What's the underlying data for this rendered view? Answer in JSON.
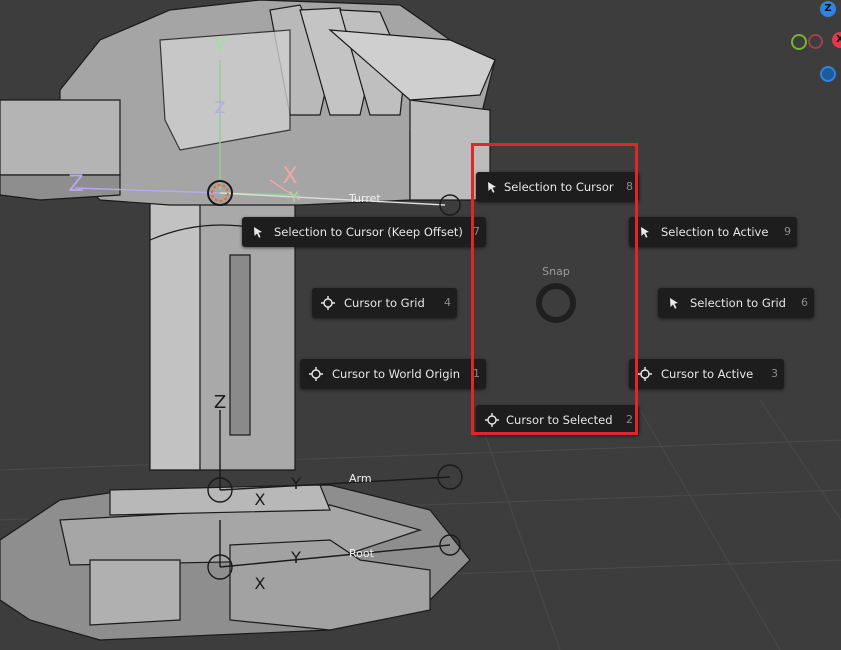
{
  "pie_menu": {
    "title": "Snap",
    "items": [
      {
        "label": "Selection to Cursor",
        "key": "8",
        "icon": "cursor-arrow-icon"
      },
      {
        "label": "Selection to Cursor (Keep Offset)",
        "key": "7",
        "icon": "cursor-arrow-icon"
      },
      {
        "label": "Selection to Active",
        "key": "9",
        "icon": "cursor-arrow-icon"
      },
      {
        "label": "Cursor to Grid",
        "key": "4",
        "icon": "3d-cursor-icon"
      },
      {
        "label": "Selection to Grid",
        "key": "6",
        "icon": "cursor-arrow-icon"
      },
      {
        "label": "Cursor to World Origin",
        "key": "1",
        "icon": "3d-cursor-icon"
      },
      {
        "label": "Cursor to Active",
        "key": "3",
        "icon": "3d-cursor-icon"
      },
      {
        "label": "Cursor to Selected",
        "key": "2",
        "icon": "3d-cursor-icon"
      }
    ]
  },
  "bones": {
    "turret": "Turret",
    "arm": "Arm",
    "root": "Root"
  },
  "axes": {
    "y": "Y",
    "z": "Z",
    "x": "X"
  },
  "nav_gizmo": {
    "z": "Z",
    "x": "X"
  },
  "colors": {
    "highlight": "#e0252b",
    "menu_bg": "#1d1d1d",
    "viewport_bg": "#3d3d3d",
    "gizmo_z": "#2f83e3",
    "gizmo_x": "#e4384a",
    "gizmo_y": "#7ab32c"
  }
}
